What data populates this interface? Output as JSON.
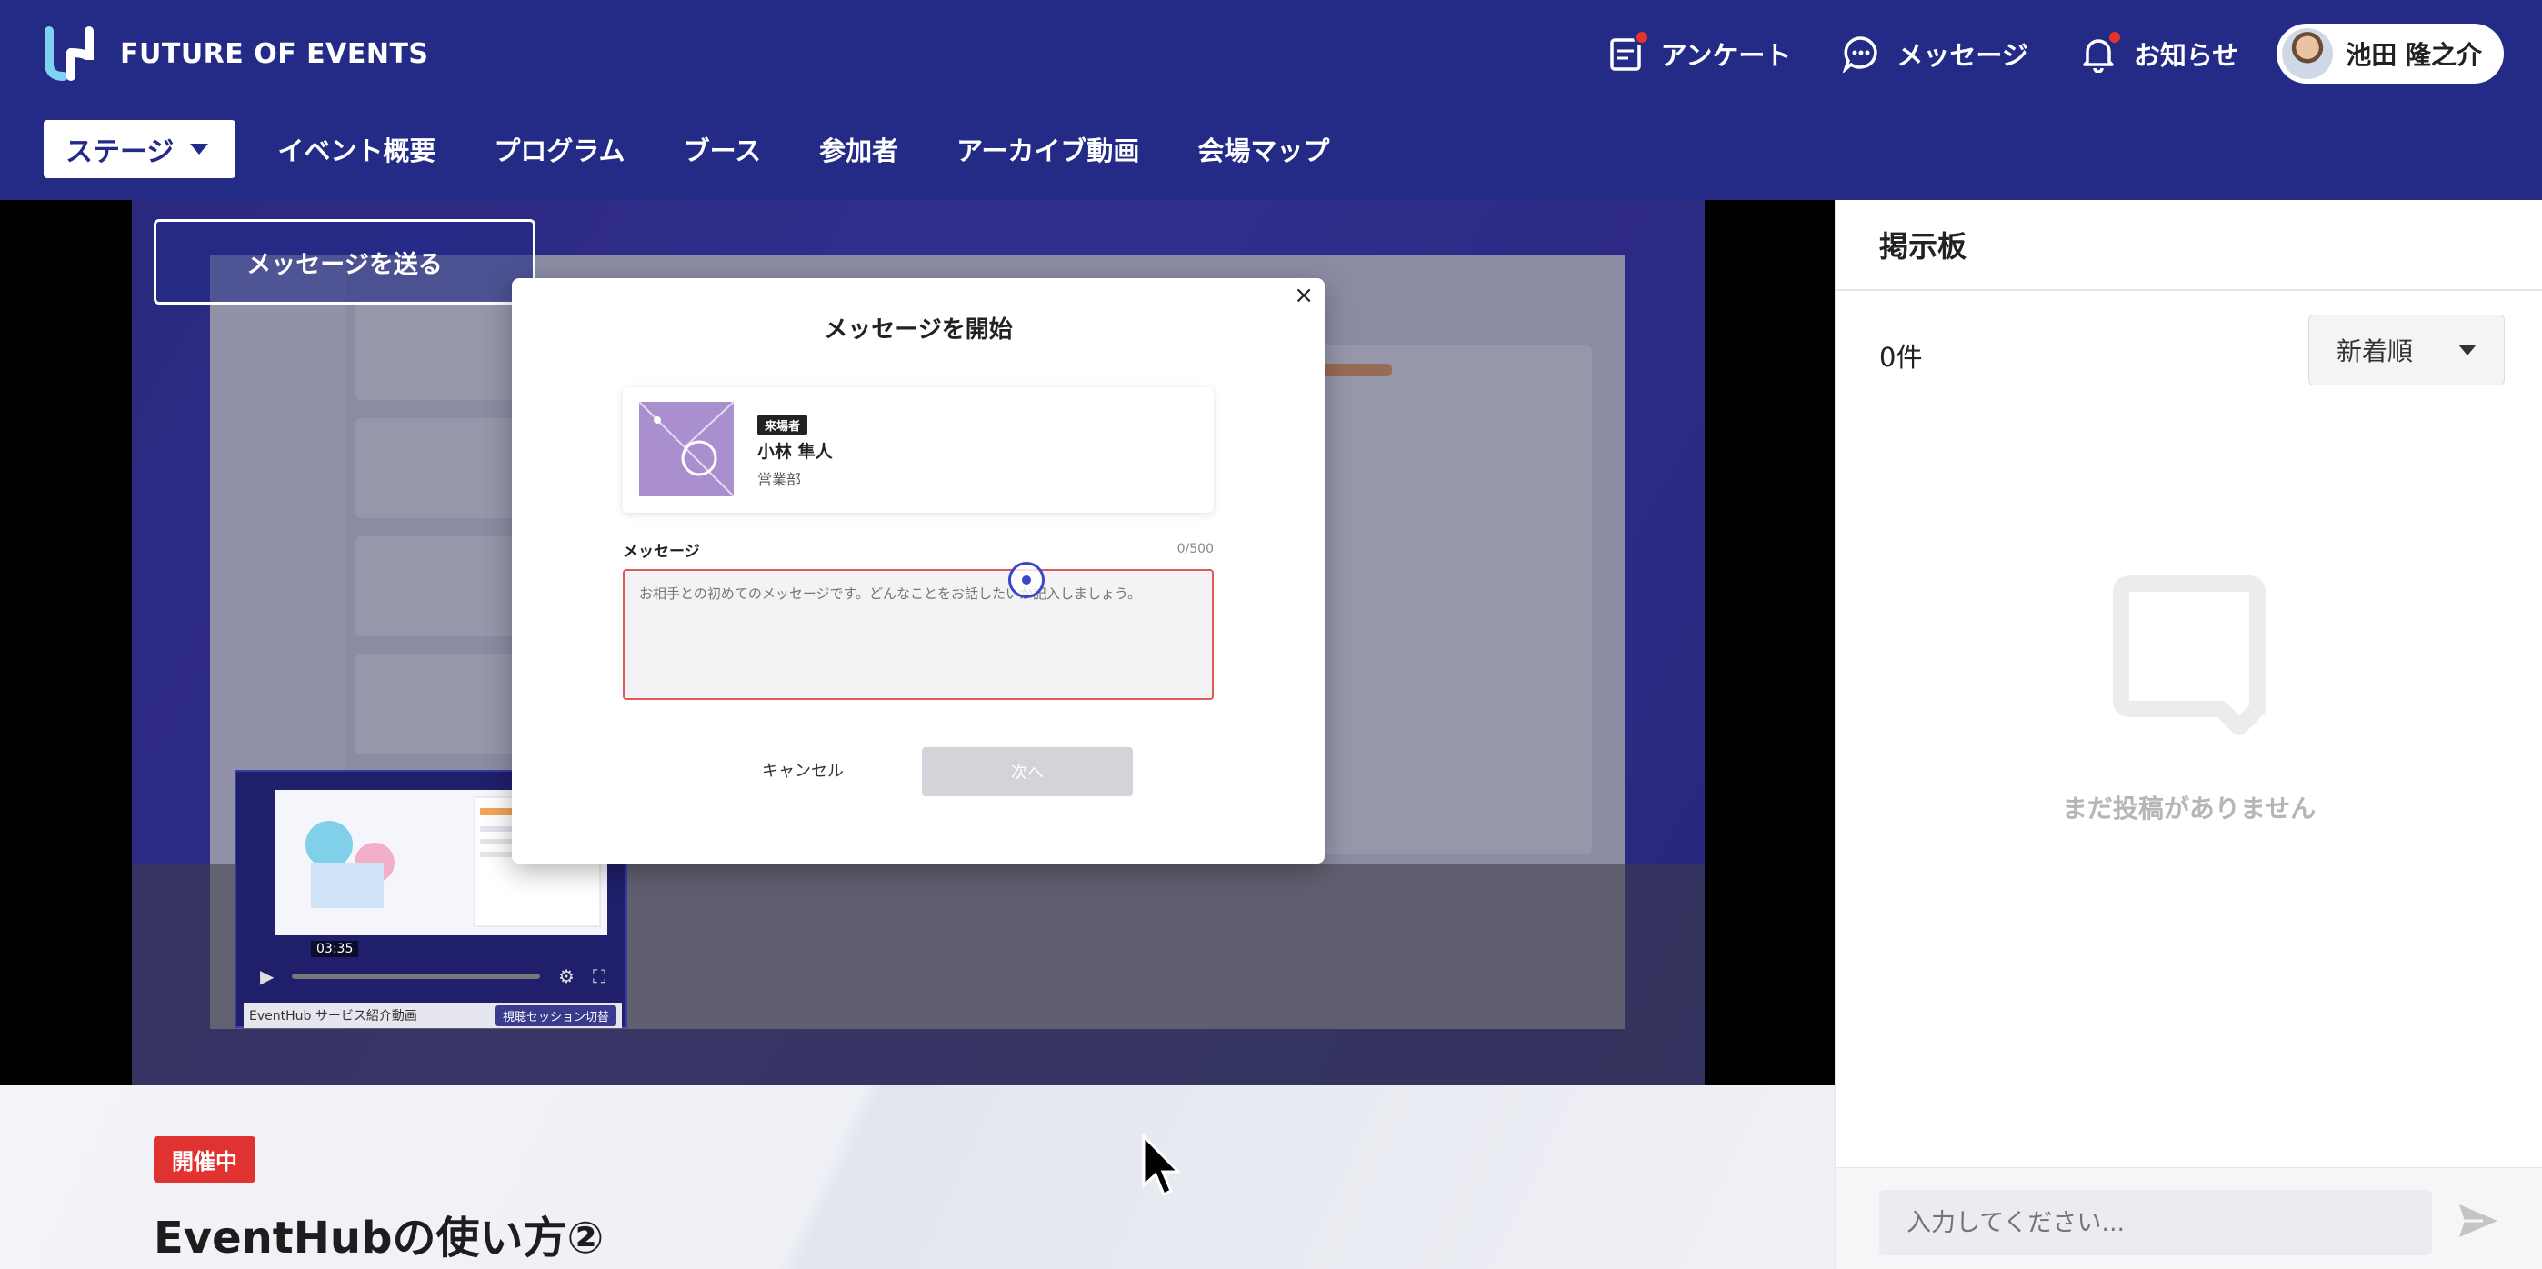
{
  "brand": {
    "name": "FUTURE OF EVENTS"
  },
  "header": {
    "survey_label": "アンケート",
    "messages_label": "メッセージ",
    "notifications_label": "お知らせ",
    "user_name": "池田 隆之介"
  },
  "nav": {
    "stage_label": "ステージ",
    "items": [
      "イベント概要",
      "プログラム",
      "ブース",
      "参加者",
      "アーカイブ動画",
      "会場マップ"
    ]
  },
  "stage": {
    "send_message_label": "メッセージを送る"
  },
  "mini_player": {
    "time": "03:35",
    "caption": "EventHub サービス紹介動画",
    "switch_label": "視聴セッション切替"
  },
  "modal": {
    "title": "メッセージを開始",
    "close_label": "×",
    "recipient": {
      "role": "来場者",
      "name": "小林 隼人",
      "department": "営業部"
    },
    "field_label": "メッセージ",
    "char_count": "0/500",
    "placeholder": "お相手との初めてのメッセージです。どんなことをお話したいか記入しましょう。",
    "cancel_label": "キャンセル",
    "next_label": "次へ"
  },
  "session": {
    "status": "開催中",
    "title": "EventHubの使い方②"
  },
  "board": {
    "title": "掲示板",
    "count": "0件",
    "sort": "新着順",
    "empty_text": "まだ投稿がありません",
    "input_placeholder": "入力してください..."
  },
  "colors": {
    "primary": "#232b87",
    "alert": "#e03331",
    "textarea_border": "#e05a5a"
  },
  "icons": [
    "logo-icon",
    "survey-icon",
    "message-icon",
    "bell-icon",
    "empty-chat-icon",
    "send-icon",
    "play-icon",
    "settings-icon",
    "fullscreen-icon",
    "close-icon"
  ]
}
